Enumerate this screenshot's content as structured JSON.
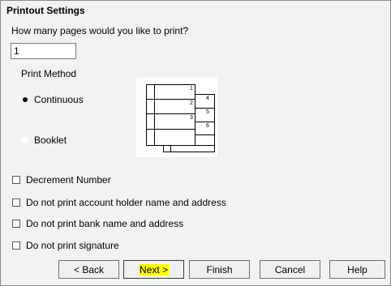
{
  "dialog": {
    "title": "Printout Settings",
    "question": "How many pages would you like to print?",
    "pages_value": "1"
  },
  "print_method": {
    "label": "Print Method",
    "options": [
      {
        "label": "Continuous",
        "selected": true
      },
      {
        "label": "Booklet",
        "selected": false
      }
    ]
  },
  "diagram": {
    "page_numbers": [
      "1",
      "2",
      "3",
      "4",
      "5",
      "6"
    ]
  },
  "options": [
    {
      "label": "Decrement Number",
      "checked": false
    },
    {
      "label": "Do not print account holder name and address",
      "checked": false
    },
    {
      "label": "Do not print bank name and address",
      "checked": false
    },
    {
      "label": "Do not print signature",
      "checked": false
    }
  ],
  "buttons": {
    "back": "< Back",
    "next": "Next >",
    "finish": "Finish",
    "cancel": "Cancel",
    "help": "Help"
  },
  "colors": {
    "highlight": "#ffff00",
    "dialog_bg": "#f2f2f2"
  }
}
